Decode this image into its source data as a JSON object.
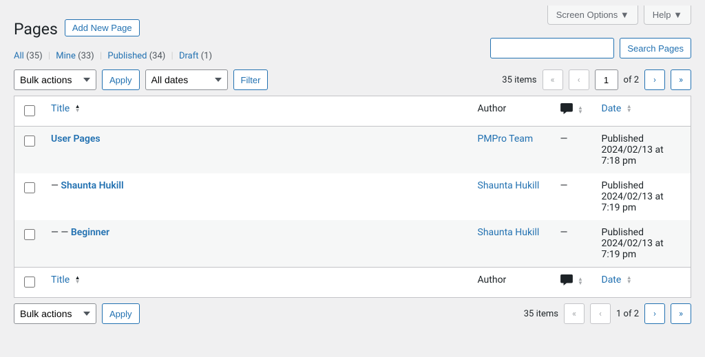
{
  "top": {
    "screen_options": "Screen Options ▼",
    "help": "Help ▼"
  },
  "heading": {
    "title": "Pages",
    "add_new": "Add New Page"
  },
  "views": {
    "all": {
      "label": "All",
      "count": "(35)"
    },
    "mine": {
      "label": "Mine",
      "count": "(33)"
    },
    "published": {
      "label": "Published",
      "count": "(34)"
    },
    "draft": {
      "label": "Draft",
      "count": "(1)"
    }
  },
  "bulk": {
    "placeholder": "Bulk actions",
    "apply": "Apply"
  },
  "filter": {
    "dates": "All dates",
    "button": "Filter"
  },
  "search": {
    "value": "",
    "button": "Search Pages"
  },
  "pagination": {
    "items_label": "35 items",
    "current": "1",
    "of": "of 2",
    "simple": "1 of 2"
  },
  "columns": {
    "title": "Title",
    "author": "Author",
    "date": "Date"
  },
  "rows": [
    {
      "title": "User Pages",
      "prefix": "",
      "author": "PMPro Team",
      "comments": "—",
      "status": "Published",
      "date": "2024/02/13 at 7:18 pm"
    },
    {
      "title": "Shaunta Hukill",
      "prefix": "— ",
      "author": "Shaunta Hukill",
      "comments": "—",
      "status": "Published",
      "date": "2024/02/13 at 7:19 pm"
    },
    {
      "title": "Beginner",
      "prefix": "— — ",
      "author": "Shaunta Hukill",
      "comments": "—",
      "status": "Published",
      "date": "2024/02/13 at 7:19 pm"
    }
  ]
}
